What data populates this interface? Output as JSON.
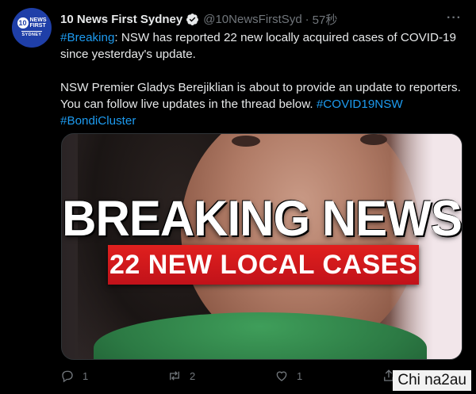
{
  "tweet": {
    "account": {
      "name": "10 News First Sydney",
      "handle": "@10NewsFirstSyd",
      "time": "57秒",
      "avatar": {
        "number": "10",
        "brand_line1": "NEWS",
        "brand_line2": "FIRST",
        "city": "SYDNEY"
      }
    },
    "text": {
      "hashtag_breaking": "#Breaking",
      "line1_rest": ": NSW has reported 22 new locally acquired cases of COVID-19 since yesterday's update.",
      "para2": "NSW Premier Gladys Berejiklian is about to provide an update to reporters. You can follow live updates in the thread below.",
      "hashtag_covid": "#COVID19NSW",
      "hashtag_bondi": "#BondiCluster"
    },
    "media": {
      "headline": "BREAKING NEWS",
      "banner": "22 NEW LOCAL CASES"
    },
    "actions": {
      "reply_count": "1",
      "retweet_count": "2",
      "like_count": "1"
    }
  },
  "watermark": "Chi na2au",
  "colors": {
    "link": "#1d9bf0",
    "muted": "#71767b",
    "text": "#e7e9ea",
    "banner_red": "#d11a1c",
    "avatar_blue": "#1f3fa8"
  },
  "icons": [
    "more-icon",
    "verified-badge-icon",
    "reply-icon",
    "retweet-icon",
    "like-icon",
    "share-icon"
  ]
}
